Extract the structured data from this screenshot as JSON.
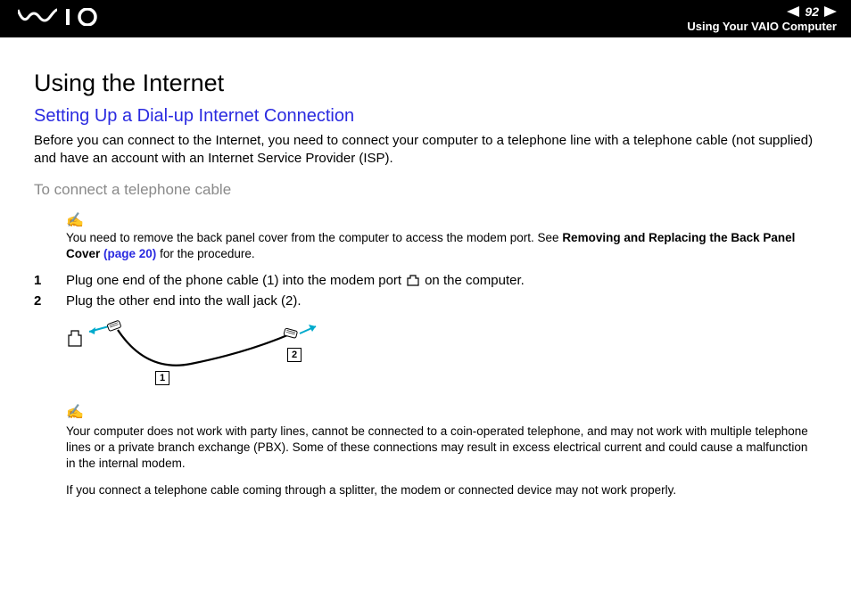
{
  "header": {
    "page_number": "92",
    "section": "Using Your VAIO Computer"
  },
  "page": {
    "title": "Using the Internet",
    "subtitle": "Setting Up a Dial-up Internet Connection",
    "intro": "Before you can connect to the Internet, you need to connect your computer to a telephone line with a telephone cable (not supplied) and have an account with an Internet Service Provider (ISP).",
    "procedure_title": "To connect a telephone cable",
    "note1_prefix": "You need to remove the back panel cover from the computer to access the modem port. See ",
    "note1_bold": "Removing and Replacing the Back Panel Cover ",
    "note1_link": "(page 20)",
    "note1_suffix": " for the procedure.",
    "steps": [
      {
        "num": "1",
        "text_before": "Plug one end of the phone cable (1) into the modem port",
        "text_after": "on the computer."
      },
      {
        "num": "2",
        "text_before": "Plug the other end into the wall jack (2).",
        "text_after": ""
      }
    ],
    "diagram": {
      "label1": "1",
      "label2": "2"
    },
    "note2_p1": "Your computer does not work with party lines, cannot be connected to a coin-operated telephone, and may not work with multiple telephone lines or a private branch exchange (PBX). Some of these connections may result in excess electrical current and could cause a malfunction in the internal modem.",
    "note2_p2": "If you connect a telephone cable coming through a splitter, the modem or connected device may not work properly."
  }
}
